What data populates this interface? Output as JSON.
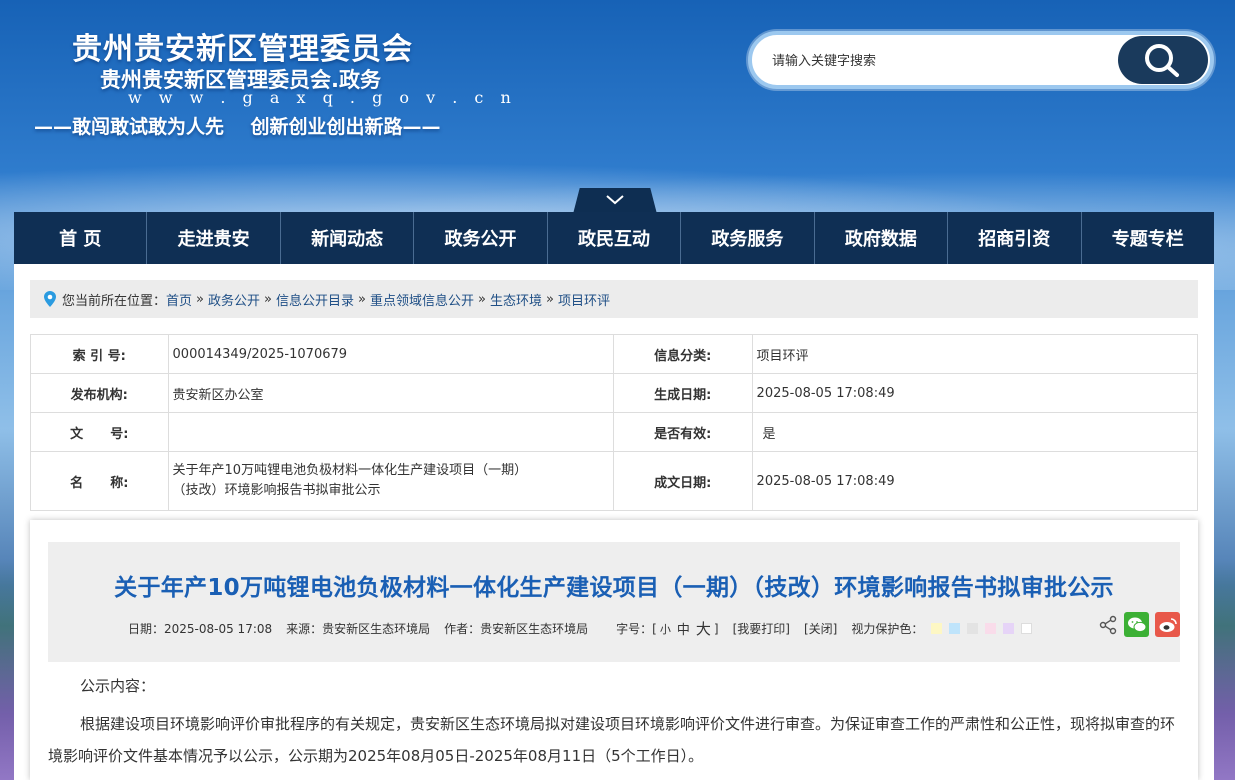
{
  "header": {
    "title": "贵州贵安新区管理委员会",
    "subtitle": "贵州贵安新区管理委员会.政务",
    "url": "w w w . g a x q . g o v . c n",
    "slogan": "——敢闯敢试敢为人先    创新创业创出新路——"
  },
  "search": {
    "placeholder": "请输入关键字搜索"
  },
  "nav": {
    "items": [
      "首 页",
      "走进贵安",
      "新闻动态",
      "政务公开",
      "政民互动",
      "政务服务",
      "政府数据",
      "招商引资",
      "专题专栏"
    ]
  },
  "breadcrumb": {
    "prefix": "您当前所在位置：",
    "items": [
      "首页",
      "政务公开",
      "信息公开目录",
      "重点领域信息公开",
      "生态环境",
      "项目环评"
    ],
    "separator": "»"
  },
  "meta": {
    "index_label": "索 引 号:",
    "index_value": "000014349/2025-1070679",
    "category_label": "信息分类:",
    "category_value": "项目环评",
    "publisher_label": "发布机构:",
    "publisher_value": "贵安新区办公室",
    "created_label": "生成日期:",
    "created_value": "2025-08-05 17:08:49",
    "docno_label": "文      号:",
    "docno_value": "",
    "valid_label": "是否有效:",
    "valid_value": "是",
    "name_label": "名      称:",
    "name_value_line1": "关于年产10万吨锂电池负极材料一体化生产建设项目（一期）",
    "name_value_line2": "（技改）环境影响报告书拟审批公示",
    "written_label": "成文日期:",
    "written_value": "2025-08-05 17:08:49"
  },
  "article": {
    "title": "关于年产10万吨锂电池负极材料一体化生产建设项目（一期）（技改）环境影响报告书拟审批公示",
    "date": "日期：2025-08-05 17:08",
    "source": "来源：贵安新区生态环境局",
    "author": "作者：贵安新区生态环境局",
    "font_label": "字号：[",
    "font_small": "小",
    "font_medium": "中",
    "font_large": "大",
    "font_end": "]",
    "print": "[我要打印]",
    "close": "[关闭]",
    "eye_label": "视力保护色：",
    "swatch_colors": [
      "#fdf7c4",
      "#bfe4fb",
      "#e3e3e3",
      "#f9dcea",
      "#e6d4f7",
      "#ffffff"
    ],
    "body_label": "公示内容：",
    "body_paragraph": "根据建设项目环境影响评价审批程序的有关规定，贵安新区生态环境局拟对建设项目环境影响评价文件进行审查。为保证审查工作的严肃性和公正性，现将拟审查的环境影响评价文件基本情况予以公示，公示期为2025年08月05日-2025年08月11日（5个工作日）。"
  }
}
